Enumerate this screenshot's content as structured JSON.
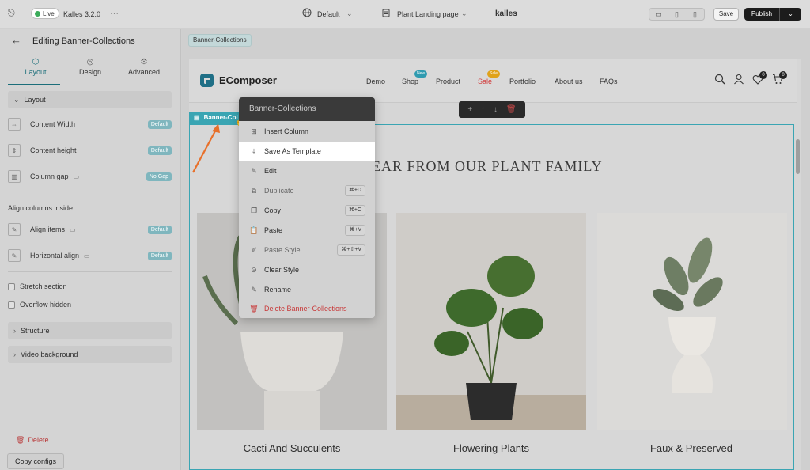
{
  "topbar": {
    "live_label": "Live",
    "theme_name": "Kalles 3.2.0",
    "more": "···",
    "language": "Default",
    "page_name": "Plant Landing page",
    "brand": "kalles",
    "save_label": "Save",
    "publish_label": "Publish"
  },
  "sidebar": {
    "title": "Editing Banner-Collections",
    "tabs": [
      {
        "label": "Layout",
        "icon": "layout-icon"
      },
      {
        "label": "Design",
        "icon": "palette-icon"
      },
      {
        "label": "Advanced",
        "icon": "gear-icon"
      }
    ],
    "layout_section": "Layout",
    "content_width": {
      "label": "Content Width",
      "value": "Default"
    },
    "content_height": {
      "label": "Content height",
      "value": "Default"
    },
    "column_gap": {
      "label": "Column gap",
      "value": "No Gap"
    },
    "align_heading": "Align columns inside",
    "align_items": {
      "label": "Align items",
      "value": "Default"
    },
    "horizontal_align": {
      "label": "Horizontal align",
      "value": "Default"
    },
    "stretch_section": "Stretch section",
    "overflow_hidden": "Overflow hidden",
    "structure": "Structure",
    "video_background": "Video background",
    "delete_label": "Delete",
    "copy_configs_label": "Copy configs"
  },
  "canvas": {
    "breadcrumb": "Banner-Collections",
    "section_tab": "Banner-Col",
    "site": {
      "logo": "EComposer",
      "nav": [
        {
          "label": "Demo"
        },
        {
          "label": "Shop",
          "badge": "New"
        },
        {
          "label": "Product"
        },
        {
          "label": "Sale",
          "badge": "Sale"
        },
        {
          "label": "Portfolio"
        },
        {
          "label": "About us"
        },
        {
          "label": "FAQs"
        }
      ],
      "wishlist_count": "0",
      "cart_count": "0"
    },
    "heading": "EAR FROM OUR PLANT FAMILY",
    "cards": [
      {
        "title": "Cacti And Succulents"
      },
      {
        "title": "Flowering Plants"
      },
      {
        "title": "Faux & Preserved"
      }
    ]
  },
  "context_menu": {
    "title": "Banner-Collections",
    "items": [
      {
        "label": "Insert Column",
        "icon": "insert-column-icon",
        "shortcut": ""
      },
      {
        "label": "Save As Template",
        "icon": "download-icon",
        "shortcut": ""
      },
      {
        "label": "Edit",
        "icon": "pencil-icon",
        "shortcut": ""
      },
      {
        "label": "Duplicate",
        "icon": "duplicate-icon",
        "shortcut": "⌘+D"
      },
      {
        "label": "Copy",
        "icon": "copy-icon",
        "shortcut": "⌘+C"
      },
      {
        "label": "Paste",
        "icon": "paste-icon",
        "shortcut": "⌘+V"
      },
      {
        "label": "Paste Style",
        "icon": "paste-style-icon",
        "shortcut": "⌘+⇧+V"
      },
      {
        "label": "Clear Style",
        "icon": "clear-style-icon",
        "shortcut": ""
      },
      {
        "label": "Rename",
        "icon": "rename-icon",
        "shortcut": ""
      },
      {
        "label": "Delete Banner-Collections",
        "icon": "trash-icon",
        "shortcut": ""
      }
    ]
  },
  "colors": {
    "accent": "#3aa5b3",
    "tab_active": "#1b6e7a",
    "danger": "#c83838",
    "live": "#3bab5a",
    "badge_new": "#2f9bb0",
    "badge_sale": "#e0a21a"
  }
}
